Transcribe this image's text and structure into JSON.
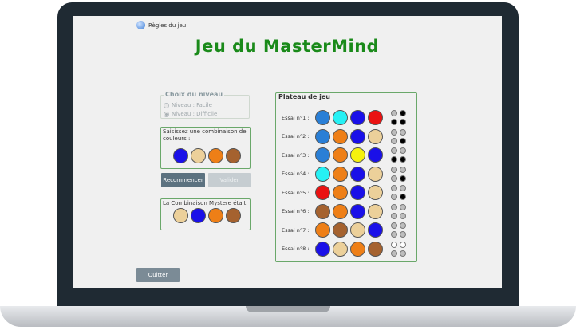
{
  "help": {
    "label": "Règles du jeu",
    "icon": "help-globe-icon"
  },
  "title": "Jeu du MasterMind",
  "level": {
    "legend": "Choix du niveau",
    "options": [
      {
        "label": "Niveau : Facile",
        "selected": false
      },
      {
        "label": "Niveau : Difficile",
        "selected": true
      }
    ]
  },
  "pick": {
    "prompt": "Saisissez une combinaison de couleurs :",
    "colors": [
      "#1a10e8",
      "#ecd09a",
      "#ee7f17",
      "#a5622f"
    ]
  },
  "buttons": {
    "restart": "Recommencer",
    "validate": "Valider",
    "quit": "Quitter"
  },
  "mystery": {
    "label": "La Combinaison Mystere était:",
    "colors": [
      "#ecd09a",
      "#1a10e8",
      "#ee7f17",
      "#a5622f"
    ]
  },
  "board": {
    "title": "Plateau de jeu",
    "trials": [
      {
        "label": "Essai n°1 :",
        "colors": [
          "#2a7fd6",
          "#26f0f4",
          "#1a10e8",
          "#ea1212"
        ],
        "feedback": [
          "#bdbdbd",
          "#000000",
          "#000000",
          "#000000"
        ]
      },
      {
        "label": "Essai n°2 :",
        "colors": [
          "#2a7fd6",
          "#ee7f17",
          "#1a10e8",
          "#ecd09a"
        ],
        "feedback": [
          "#bdbdbd",
          "#bdbdbd",
          "#bdbdbd",
          "#000000"
        ]
      },
      {
        "label": "Essai n°3 :",
        "colors": [
          "#2a7fd6",
          "#ee7f17",
          "#f5f20e",
          "#1a10e8"
        ],
        "feedback": [
          "#bdbdbd",
          "#bdbdbd",
          "#000000",
          "#000000"
        ]
      },
      {
        "label": "Essai n°4 :",
        "colors": [
          "#26f0f4",
          "#ee7f17",
          "#1a10e8",
          "#ecd09a"
        ],
        "feedback": [
          "#bdbdbd",
          "#bdbdbd",
          "#bdbdbd",
          "#000000"
        ]
      },
      {
        "label": "Essai n°5 :",
        "colors": [
          "#ea1212",
          "#ee7f17",
          "#1a10e8",
          "#ecd09a"
        ],
        "feedback": [
          "#bdbdbd",
          "#bdbdbd",
          "#bdbdbd",
          "#000000"
        ]
      },
      {
        "label": "Essai n°6 :",
        "colors": [
          "#a5622f",
          "#ee7f17",
          "#1a10e8",
          "#ecd09a"
        ],
        "feedback": [
          "#bdbdbd",
          "#bdbdbd",
          "#bdbdbd",
          "#bdbdbd"
        ]
      },
      {
        "label": "Essai n°7 :",
        "colors": [
          "#ee7f17",
          "#a5622f",
          "#ecd09a",
          "#1a10e8"
        ],
        "feedback": [
          "#bdbdbd",
          "#bdbdbd",
          "#bdbdbd",
          "#bdbdbd"
        ]
      },
      {
        "label": "Essai n°8 :",
        "colors": [
          "#1a10e8",
          "#ecd09a",
          "#ee7f17",
          "#a5622f"
        ],
        "feedback": [
          "#ffffff",
          "#ffffff",
          "#bdbdbd",
          "#bdbdbd"
        ]
      }
    ]
  }
}
